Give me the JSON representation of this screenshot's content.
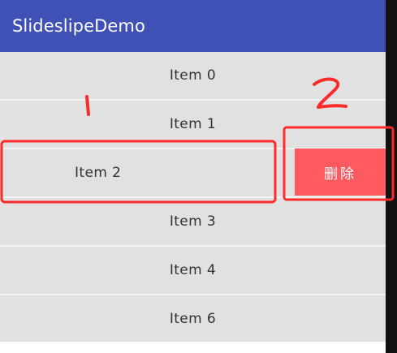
{
  "app_bar": {
    "title": "SlideslipeDemo",
    "color": "#3f51b5"
  },
  "list": {
    "items": [
      {
        "label": "Item  0"
      },
      {
        "label": "Item  1"
      },
      {
        "label": "Item  2",
        "swiped_open": true
      },
      {
        "label": "Item  3"
      },
      {
        "label": "Item  4"
      },
      {
        "label": "Item  6"
      }
    ],
    "delete_action": {
      "label": "删除",
      "color": "#ff5a5f"
    }
  },
  "annotations": {
    "marker_1": "1",
    "marker_2": "2",
    "color": "#ff2a2a"
  }
}
